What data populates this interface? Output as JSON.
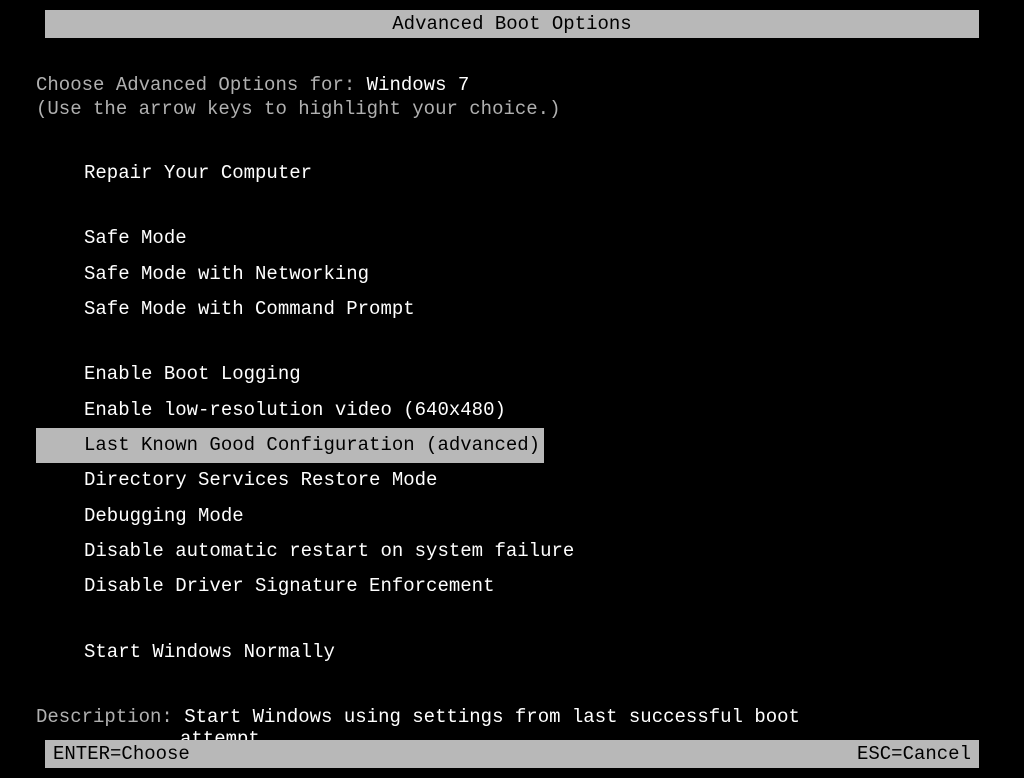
{
  "title": "Advanced Boot Options",
  "prompt": {
    "label": "Choose Advanced Options for: ",
    "os": "Windows 7"
  },
  "instruction": "(Use the arrow keys to highlight your choice.)",
  "groups": [
    {
      "items": [
        {
          "label": "Repair Your Computer",
          "selected": false
        }
      ]
    },
    {
      "items": [
        {
          "label": "Safe Mode",
          "selected": false
        },
        {
          "label": "Safe Mode with Networking",
          "selected": false
        },
        {
          "label": "Safe Mode with Command Prompt",
          "selected": false
        }
      ]
    },
    {
      "items": [
        {
          "label": "Enable Boot Logging",
          "selected": false
        },
        {
          "label": "Enable low-resolution video (640x480)",
          "selected": false
        },
        {
          "label": "Last Known Good Configuration (advanced)",
          "selected": true
        },
        {
          "label": "Directory Services Restore Mode",
          "selected": false
        },
        {
          "label": "Debugging Mode",
          "selected": false
        },
        {
          "label": "Disable automatic restart on system failure",
          "selected": false
        },
        {
          "label": "Disable Driver Signature Enforcement",
          "selected": false
        }
      ]
    },
    {
      "items": [
        {
          "label": "Start Windows Normally",
          "selected": false
        }
      ]
    }
  ],
  "description": {
    "label": "Description: ",
    "line1": "Start Windows using settings from last successful boot",
    "line2": "attempt."
  },
  "footer": {
    "enter": "ENTER=Choose",
    "esc": "ESC=Cancel"
  }
}
